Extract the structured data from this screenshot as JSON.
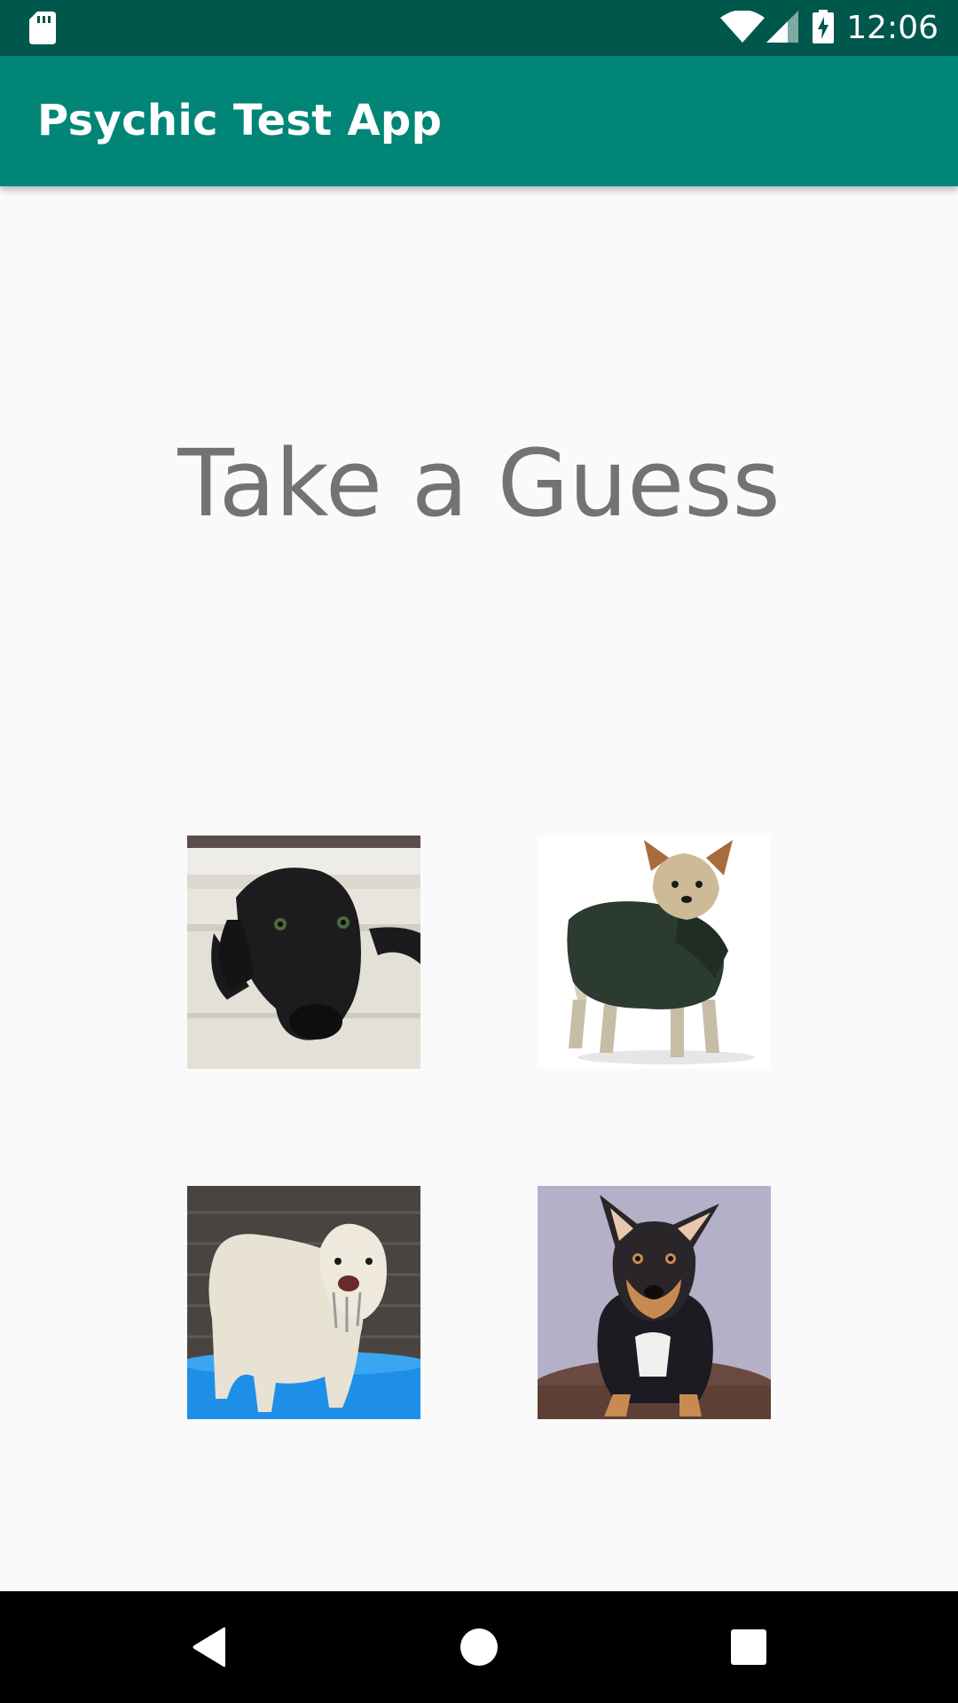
{
  "status_bar": {
    "time": "12:06",
    "icons": [
      "sd-card-icon",
      "wifi-icon",
      "cell-signal-icon",
      "battery-charging-icon"
    ]
  },
  "app_bar": {
    "title": "Psychic Test App",
    "color": "#008577",
    "status_color": "#00574b"
  },
  "main": {
    "headline": "Take a Guess",
    "choices": [
      {
        "name": "black-labrador"
      },
      {
        "name": "yorkie-in-jacket"
      },
      {
        "name": "white-shaggy-dog"
      },
      {
        "name": "kelpie-mix"
      }
    ]
  },
  "nav_bar": {
    "buttons": [
      "back-icon",
      "home-icon",
      "recent-apps-icon"
    ]
  }
}
